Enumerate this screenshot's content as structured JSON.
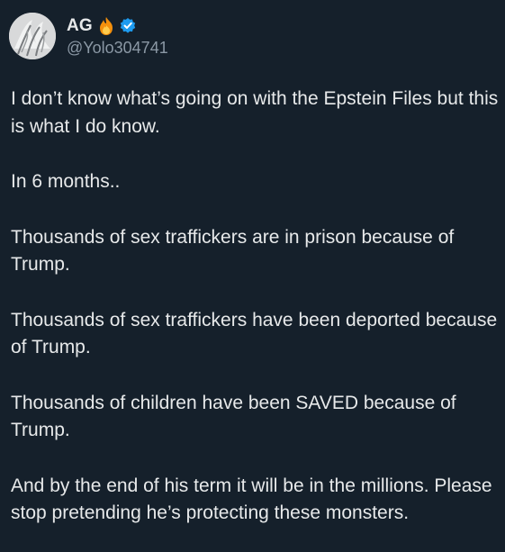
{
  "author": {
    "display_name": "AG",
    "handle": "@Yolo304741",
    "badge_icons": [
      "fire-icon",
      "verified-icon"
    ]
  },
  "post": {
    "paragraphs": [
      "I don’t know what’s going on with the Epstein Files but this is what I do know.",
      "In 6 months..",
      "Thousands of sex traffickers are in prison because of Trump.",
      "Thousands of sex traffickers have been deported because of Trump.",
      "Thousands of children have been SAVED because of Trump.",
      "And by the end of his term it will be in the millions. Please stop pretending he’s protecting these monsters."
    ]
  },
  "colors": {
    "background": "#15202b",
    "text": "#e7e9ea",
    "secondary_text": "#8b98a5",
    "verified": "#1d9bf0"
  }
}
